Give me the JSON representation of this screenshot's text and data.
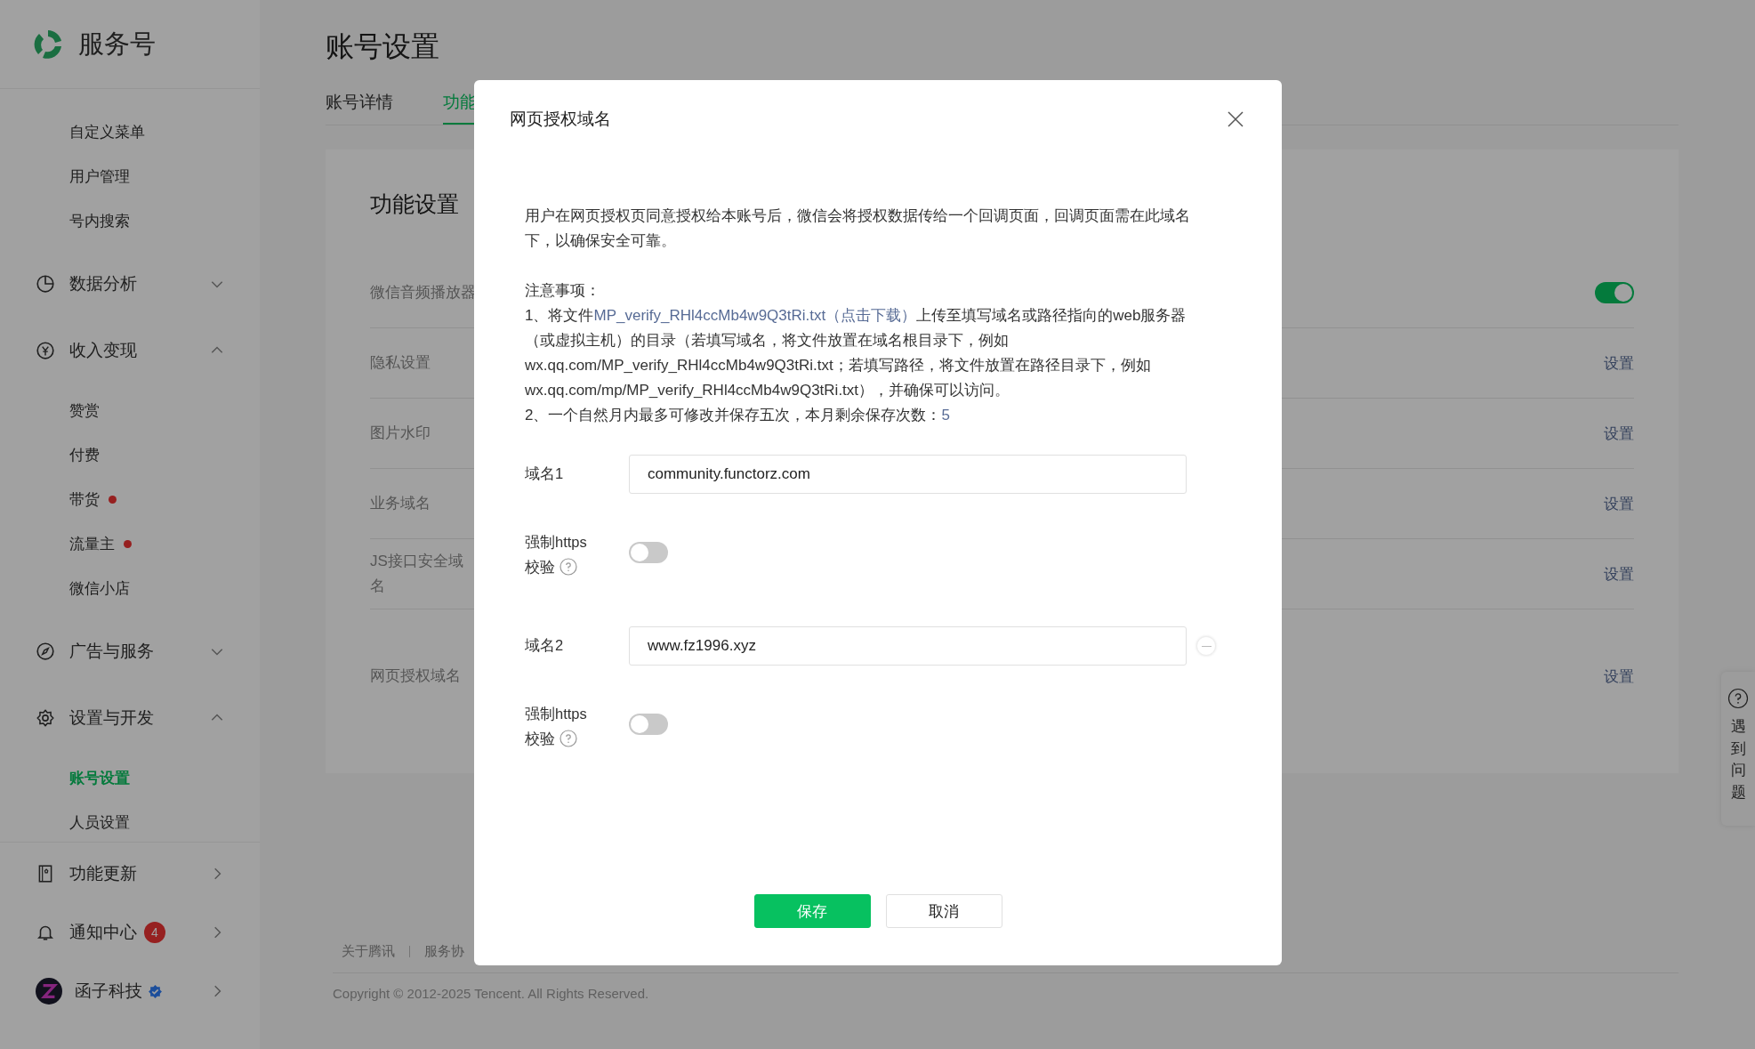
{
  "sidebar": {
    "brand": "服务号",
    "items": [
      {
        "kind": "sub",
        "label": "自定义菜单",
        "selected": false,
        "dot": false
      },
      {
        "kind": "sub",
        "label": "用户管理",
        "selected": false,
        "dot": false
      },
      {
        "kind": "sub",
        "label": "号内搜索",
        "selected": false,
        "dot": false
      },
      {
        "kind": "group",
        "label": "数据分析",
        "expanded": false
      },
      {
        "kind": "group",
        "label": "收入变现",
        "expanded": true
      },
      {
        "kind": "sub",
        "label": "赞赏",
        "selected": false,
        "dot": false
      },
      {
        "kind": "sub",
        "label": "付费",
        "selected": false,
        "dot": false
      },
      {
        "kind": "sub",
        "label": "带货",
        "selected": false,
        "dot": true
      },
      {
        "kind": "sub",
        "label": "流量主",
        "selected": false,
        "dot": true
      },
      {
        "kind": "sub",
        "label": "微信小店",
        "selected": false,
        "dot": false
      },
      {
        "kind": "group",
        "label": "广告与服务",
        "expanded": false
      },
      {
        "kind": "group",
        "label": "设置与开发",
        "expanded": true
      },
      {
        "kind": "sub",
        "label": "账号设置",
        "selected": true,
        "dot": false
      },
      {
        "kind": "sub",
        "label": "人员设置",
        "selected": false,
        "dot": false
      }
    ],
    "bottom": [
      {
        "kind": "page",
        "label": "功能更新"
      },
      {
        "kind": "inbox",
        "label": "通知中心",
        "badge": "4"
      },
      {
        "kind": "profile",
        "label": "函子科技",
        "verified": true
      }
    ]
  },
  "page": {
    "title": "账号设置",
    "tabs": [
      {
        "label": "账号详情",
        "selected": false
      },
      {
        "label": "功能",
        "selected": true
      }
    ],
    "card_title": "功能设置",
    "rows": [
      {
        "kind": "toggle",
        "label": "微信音频播放器",
        "on": true
      },
      {
        "kind": "link",
        "label": "隐私设置",
        "action": "设置"
      },
      {
        "kind": "link",
        "label": "图片水印",
        "action": "设置"
      },
      {
        "kind": "link",
        "label": "业务域名",
        "action": "设置"
      },
      {
        "kind": "link",
        "label": "JS接口安全域名",
        "action": "设置"
      },
      {
        "kind": "link",
        "label": "网页授权域名",
        "action": "设置"
      }
    ],
    "footer_links": [
      "关于腾讯",
      "服务协"
    ],
    "copyright": "Copyright © 2012-2025 Tencent. All Rights Reserved."
  },
  "help": {
    "label": "遇到问题"
  },
  "dialog": {
    "title": "网页授权域名",
    "intro": "用户在网页授权页同意授权给本账号后，微信会将授权数据传给一个回调页面，回调页面需在此域名下，以确保安全可靠。",
    "notes_title": "注意事项：",
    "note1_before": "1、将文件",
    "note1_link": "MP_verify_RHl4ccMb4w9Q3tRi.txt（点击下载）",
    "note1_after": "上传至填写域名或路径指向的web服务器（或虚拟主机）的目录（若填写域名，将文件放置在域名根目录下，例如wx.qq.com/MP_verify_RHl4ccMb4w9Q3tRi.txt；若填写路径，将文件放置在路径目录下，例如wx.qq.com/mp/MP_verify_RHl4ccMb4w9Q3tRi.txt），并确保可以访问。",
    "note2": "2、一个自然月内最多可修改并保存五次，本月剩余保存次数：",
    "note2_count": "5",
    "domains": [
      {
        "label": "域名1",
        "value": "community.functorz.com",
        "removable": false,
        "https_label": "强制https",
        "verify_label": "校验",
        "https": false
      },
      {
        "label": "域名2",
        "value": "www.fz1996.xyz",
        "removable": true,
        "https_label": "强制https",
        "verify_label": "校验",
        "https": false
      }
    ],
    "save": "保存",
    "cancel": "取消"
  }
}
